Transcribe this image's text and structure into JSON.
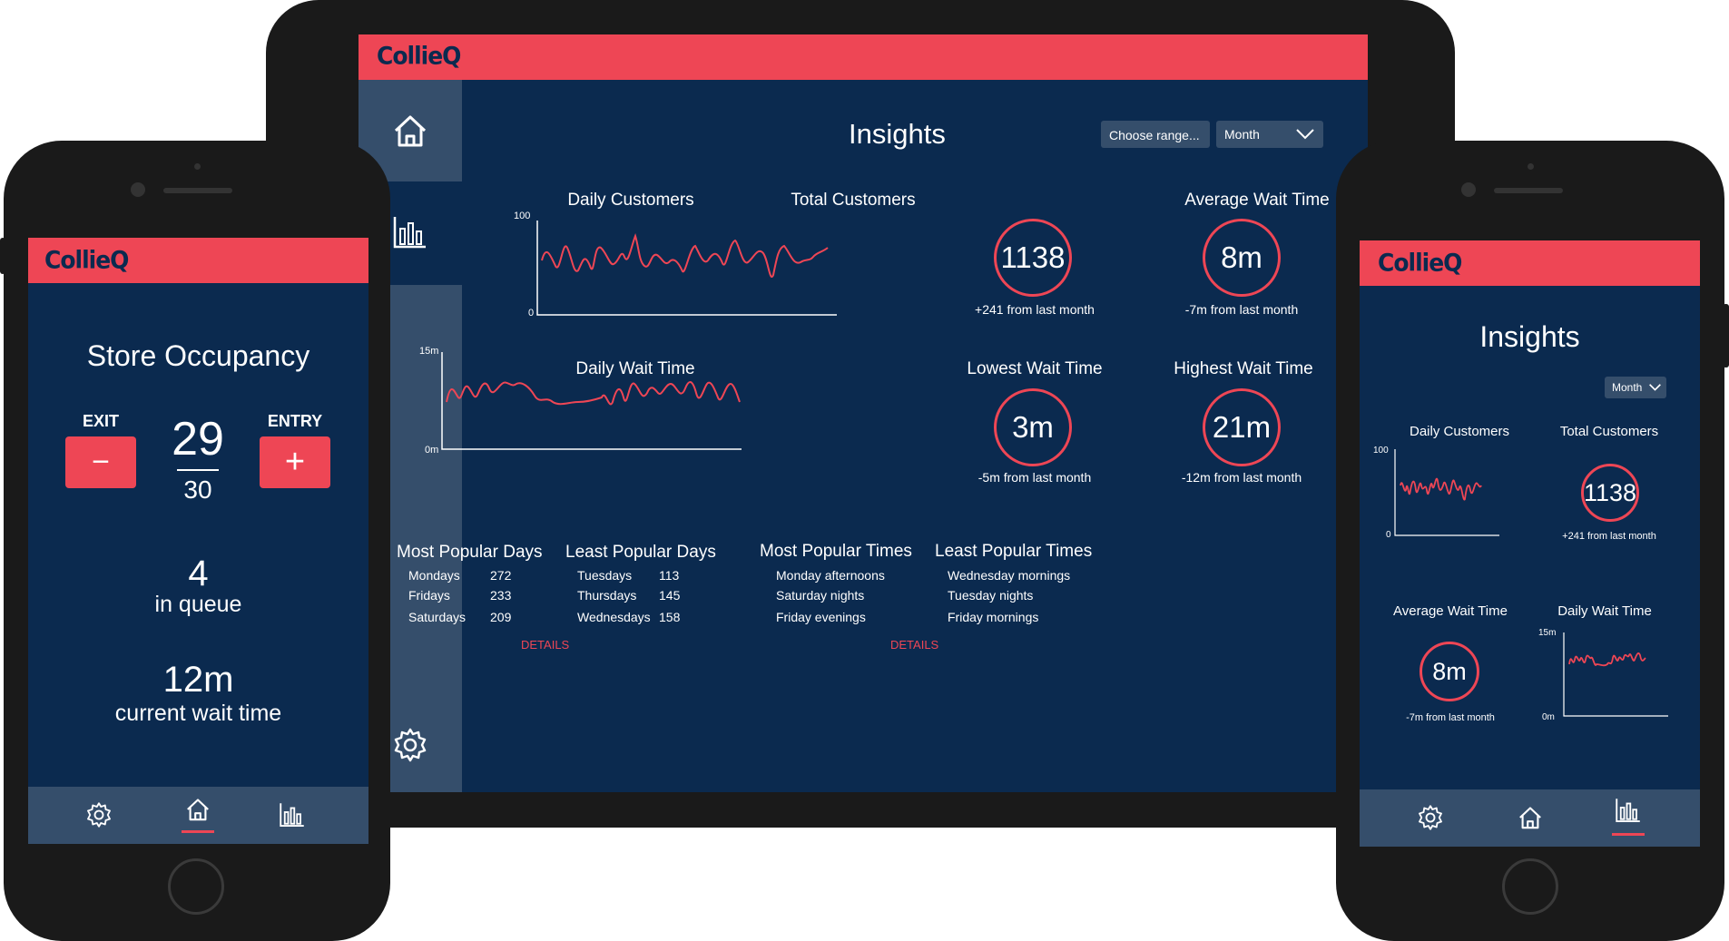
{
  "colors": {
    "navy": "#0b2a4f",
    "slate": "#354e6b",
    "accent": "#ee4655",
    "device": "#1a1a1a"
  },
  "brand": "CollieQ",
  "tablet": {
    "title": "Insights",
    "range_label": "Choose range...",
    "period_label": "Month",
    "sidebar_icons": [
      "home-icon",
      "bar-chart-icon",
      "gear-icon"
    ],
    "daily_customers": {
      "title": "Daily Customers",
      "y_top": "100",
      "y_bottom": "0"
    },
    "daily_wait": {
      "title": "Daily Wait Time",
      "y_top": "15m",
      "y_bottom": "0m"
    },
    "stats": [
      {
        "label": "Total Customers",
        "value": "1138",
        "delta": "+241 from last month"
      },
      {
        "label": "Average Wait Time",
        "value": "8m",
        "delta": "-7m from last month"
      },
      {
        "label": "Lowest Wait Time",
        "value": "3m",
        "delta": "-5m from last month"
      },
      {
        "label": "Highest Wait Time",
        "value": "21m",
        "delta": "-12m from last month"
      }
    ],
    "popular_days": {
      "title": "Most Popular Days",
      "rows": [
        [
          "Mondays",
          "272"
        ],
        [
          "Fridays",
          "233"
        ],
        [
          "Saturdays",
          "209"
        ]
      ]
    },
    "least_days": {
      "title": "Least Popular Days",
      "rows": [
        [
          "Tuesdays",
          "113"
        ],
        [
          "Thursdays",
          "145"
        ],
        [
          "Wednesdays",
          "158"
        ]
      ]
    },
    "popular_times": {
      "title": "Most Popular Times",
      "rows": [
        "Monday afternoons",
        "Saturday nights",
        "Friday evenings"
      ]
    },
    "least_times": {
      "title": "Least Popular Times",
      "rows": [
        "Wednesday mornings",
        "Tuesday nights",
        "Friday mornings"
      ]
    },
    "details_label": "DETAILS"
  },
  "phone_left": {
    "title": "Store Occupancy",
    "exit_label": "EXIT",
    "entry_label": "ENTRY",
    "minus": "−",
    "plus": "+",
    "occupancy": "29",
    "capacity": "30",
    "queue_value": "4",
    "queue_label": "in queue",
    "wait_value": "12m",
    "wait_label": "current wait time",
    "active_tab": "home"
  },
  "phone_right": {
    "title": "Insights",
    "period_label": "Month",
    "daily_customers": {
      "title": "Daily Customers",
      "y_top": "100",
      "y_bottom": "0"
    },
    "total_customers": {
      "label": "Total Customers",
      "value": "1138",
      "delta": "+241 from last month"
    },
    "avg_wait": {
      "label": "Average Wait Time",
      "value": "8m",
      "delta": "-7m from last month"
    },
    "daily_wait": {
      "title": "Daily Wait Time",
      "y_top": "15m",
      "y_bottom": "0m"
    },
    "active_tab": "insights"
  }
}
